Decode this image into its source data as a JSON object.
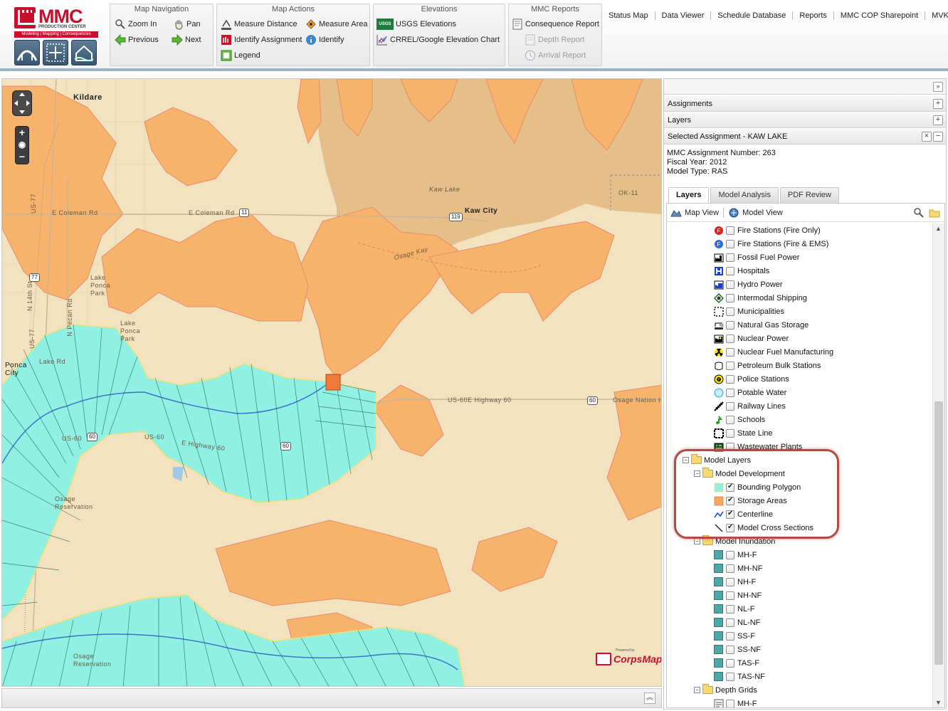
{
  "logo": {
    "brand": "MMC",
    "subtitle": "PRODUCTION CENTER",
    "tagline": "Modeling | Mapping | Consequences"
  },
  "toolbar": {
    "map_navigation": {
      "title": "Map Navigation",
      "zoom_in": "Zoom In",
      "pan": "Pan",
      "previous": "Previous",
      "next": "Next"
    },
    "map_actions": {
      "title": "Map Actions",
      "measure_distance": "Measure Distance",
      "measure_area": "Measure Area",
      "identify_assignment": "Identify Assignment",
      "identify": "Identify",
      "legend": "Legend"
    },
    "elevations": {
      "title": "Elevations",
      "usgs": "USGS Elevations",
      "crrel": "CRREL/Google Elevation Chart",
      "usgs_badge": "USGS"
    },
    "mmc_reports": {
      "title": "MMC Reports",
      "consequence": "Consequence Report",
      "depth": "Depth Report",
      "arrival": "Arrival Report"
    }
  },
  "topnav": [
    "Status Map",
    "Data Viewer",
    "Schedule Database",
    "Reports",
    "MMC COP Sharepoint",
    "MVK"
  ],
  "map": {
    "labels": {
      "kildare": "Kildare",
      "kaw_city": "Kaw City",
      "kaw_lake": "Kaw Lake",
      "ponca_city": "Ponca City",
      "lake_ponca_park1": "Lake Ponca Park",
      "lake_ponca_park2": "Lake Ponca Park",
      "e_coleman_rd1": "E Coleman Rd",
      "e_coleman_rd2": "E Coleman Rd",
      "us77": "US-77",
      "us77_2": "US-77",
      "n14th": "N 14th St",
      "n_pecan": "N Pecan Rd",
      "lake_rd": "Lake Rd",
      "us60e": "US-60E Highway 60",
      "osage_nation": "Osage Nation H",
      "e_highway60": "E Highway 60",
      "us60": "US-60",
      "us60_2": "US-60",
      "ok11": "OK-11",
      "osage_reservation1": "Osage Reservation",
      "osage_reservation2": "Osage Reservation",
      "osage_kay": "Osage Kay"
    },
    "shields": {
      "s11": "11",
      "s119": "119",
      "s77": "77",
      "s60a": "60",
      "s60b": "60",
      "s60c": "60"
    },
    "corpsmap": {
      "name": "CorpsMap",
      "powered": "Powered by"
    }
  },
  "panel": {
    "assignments": "Assignments",
    "layers": "Layers",
    "selected_assignment": "Selected Assignment - KAW LAKE",
    "info": {
      "number": "MMC Assignment Number: 263",
      "fiscal_year": "Fiscal Year: 2012",
      "model_type": "Model Type: RAS"
    },
    "tabs": [
      "Layers",
      "Model Analysis",
      "PDF Review"
    ],
    "view_bar": {
      "map_view": "Map View",
      "model_view": "Model View"
    },
    "tree": [
      {
        "label": "Fire Stations (Fire Only)",
        "checked": false,
        "icon": "fire-red-icon"
      },
      {
        "label": "Fire Stations (Fire & EMS)",
        "checked": false,
        "icon": "fire-blue-icon"
      },
      {
        "label": "Fossil Fuel Power",
        "checked": false,
        "icon": "factory-icon"
      },
      {
        "label": "Hospitals",
        "checked": false,
        "icon": "hospital-icon"
      },
      {
        "label": "Hydro Power",
        "checked": false,
        "icon": "hydro-icon"
      },
      {
        "label": "Intermodal Shipping",
        "checked": false,
        "icon": "shipping-icon"
      },
      {
        "label": "Municipalities",
        "checked": false,
        "icon": "municipality-icon"
      },
      {
        "label": "Natural Gas Storage",
        "checked": false,
        "icon": "gas-icon"
      },
      {
        "label": "Nuclear Power",
        "checked": false,
        "icon": "nuclear-power-icon"
      },
      {
        "label": "Nuclear Fuel Manufacturing",
        "checked": false,
        "icon": "radiation-icon"
      },
      {
        "label": "Petroleum Bulk Stations",
        "checked": false,
        "icon": "petroleum-icon"
      },
      {
        "label": "Police Stations",
        "checked": false,
        "icon": "police-icon"
      },
      {
        "label": "Potable Water",
        "checked": false,
        "icon": "water-icon"
      },
      {
        "label": "Railway Lines",
        "checked": false,
        "icon": "rail-icon"
      },
      {
        "label": "Schools",
        "checked": false,
        "icon": "school-icon"
      },
      {
        "label": "State Line",
        "checked": false,
        "icon": "state-line-icon"
      },
      {
        "label": "Wastewater Plants",
        "checked": false,
        "icon": "wastewater-icon"
      }
    ],
    "model_layers": "Model Layers",
    "model_development": "Model Development",
    "dev_layers": [
      {
        "label": "Bounding Polygon",
        "checked": true,
        "color": "#8ff0e3"
      },
      {
        "label": "Storage Areas",
        "checked": true,
        "color": "#f7a65d"
      },
      {
        "label": "Centerline",
        "checked": true,
        "color": "#1f4fd6"
      },
      {
        "label": "Model Cross Sections",
        "checked": true,
        "color": "#222222"
      }
    ],
    "model_inundation": "Model Inundation",
    "inundation": [
      "MH-F",
      "MH-NF",
      "NH-F",
      "NH-NF",
      "NL-F",
      "NL-NF",
      "SS-F",
      "SS-NF",
      "TAS-F",
      "TAS-NF"
    ],
    "depth_grids": "Depth Grids",
    "depth": [
      "MH-F"
    ]
  },
  "colors": {
    "accent": "#c8102e",
    "highlight": "#b14b43",
    "bounding": "#8ff0e3",
    "storage": "#f7a65d",
    "land": "#f3e2c0",
    "lake": "#e5be8a"
  }
}
